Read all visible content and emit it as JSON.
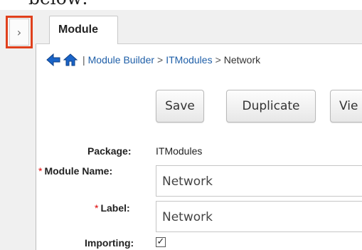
{
  "caption": "below:",
  "sidebar": {
    "toggle_icon": "›"
  },
  "tabs": [
    {
      "label": "Module"
    }
  ],
  "breadcrumb": {
    "back_icon": "arrow-left-icon",
    "home_icon": "home-icon",
    "separator": "|",
    "items": [
      {
        "label": "Module Builder",
        "after": ">"
      },
      {
        "label": "ITModules",
        "after": ">"
      },
      {
        "label": "Network",
        "after": ""
      }
    ]
  },
  "actions": {
    "save": "Save",
    "duplicate": "Duplicate",
    "view": "Vie"
  },
  "form": {
    "package_label": "Package:",
    "package_value": "ITModules",
    "module_name_label": "Module Name:",
    "module_name_value": "Network",
    "label_label": "Label:",
    "label_value": "Network",
    "importing_label": "Importing:",
    "importing_checked": true,
    "required_marker": "*"
  },
  "colors": {
    "link": "#1f5fa8",
    "required": "#dd0000",
    "highlight": "#e0401c",
    "icon_blue": "#1a64c8"
  }
}
